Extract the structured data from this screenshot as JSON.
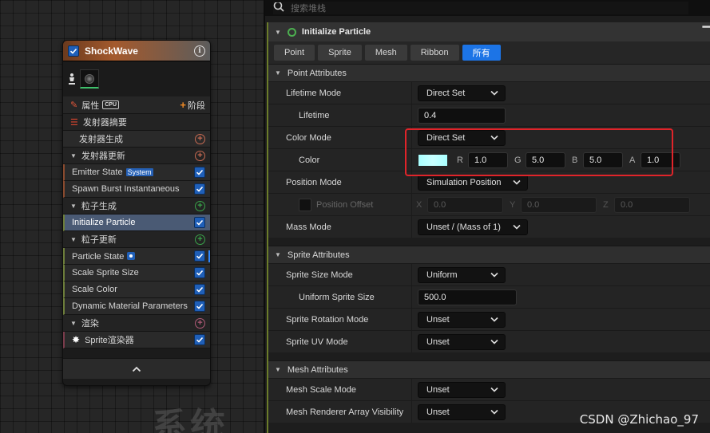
{
  "canvas": {
    "watermark": "系统"
  },
  "node": {
    "title": "ShockWave",
    "properties_label": "属性",
    "cpu_badge": "CPU",
    "stage_label": "阶段",
    "emitter_summary": "发射器摘要",
    "emitter_spawn": "发射器生成",
    "emitter_update": "发射器更新",
    "emitter_state": "Emitter State",
    "system_badge": "System",
    "spawn_burst": "Spawn Burst Instantaneous",
    "particle_spawn": "粒子生成",
    "initialize_particle": "Initialize Particle",
    "particle_update": "粒子更新",
    "particle_state": "Particle State",
    "scale_sprite_size": "Scale Sprite Size",
    "scale_color": "Scale Color",
    "dynamic_material": "Dynamic Material Parameters",
    "render": "渲染",
    "sprite_renderer": "Sprite渲染器"
  },
  "panel": {
    "search_placeholder": "搜索堆栈",
    "module_title": "Initialize Particle",
    "tabs": [
      "Point",
      "Sprite",
      "Mesh",
      "Ribbon",
      "所有"
    ],
    "active_tab": "所有",
    "point_attributes": {
      "header": "Point Attributes",
      "lifetime_mode_label": "Lifetime Mode",
      "lifetime_mode_value": "Direct Set",
      "lifetime_label": "Lifetime",
      "lifetime_value": "0.4",
      "color_mode_label": "Color Mode",
      "color_mode_value": "Direct Set",
      "color_label": "Color",
      "color_swatch": "#a8ffff",
      "color_r_label": "R",
      "color_r": "1.0",
      "color_g_label": "G",
      "color_g": "5.0",
      "color_b_label": "B",
      "color_b": "5.0",
      "color_a_label": "A",
      "color_a": "1.0",
      "position_mode_label": "Position Mode",
      "position_mode_value": "Simulation Position",
      "position_offset_label": "Position Offset",
      "offset_x_label": "X",
      "offset_x": "0.0",
      "offset_y_label": "Y",
      "offset_y": "0.0",
      "offset_z_label": "Z",
      "offset_z": "0.0",
      "mass_mode_label": "Mass Mode",
      "mass_mode_value": "Unset / (Mass of 1)"
    },
    "sprite_attributes": {
      "header": "Sprite Attributes",
      "size_mode_label": "Sprite Size Mode",
      "size_mode_value": "Uniform",
      "uniform_size_label": "Uniform Sprite Size",
      "uniform_size_value": "500.0",
      "rotation_mode_label": "Sprite Rotation Mode",
      "rotation_mode_value": "Unset",
      "uv_mode_label": "Sprite UV Mode",
      "uv_mode_value": "Unset"
    },
    "mesh_attributes": {
      "header": "Mesh Attributes",
      "scale_mode_label": "Mesh Scale Mode",
      "scale_mode_value": "Unset",
      "array_visibility_label": "Mesh Renderer Array Visibility",
      "array_visibility_value": "Unset"
    }
  },
  "footer_watermark": "CSDN @Zhichao_97",
  "colors": {
    "accent_blue": "#1c74e6",
    "highlight_red": "#e0242a",
    "module_green": "#4caf50"
  }
}
